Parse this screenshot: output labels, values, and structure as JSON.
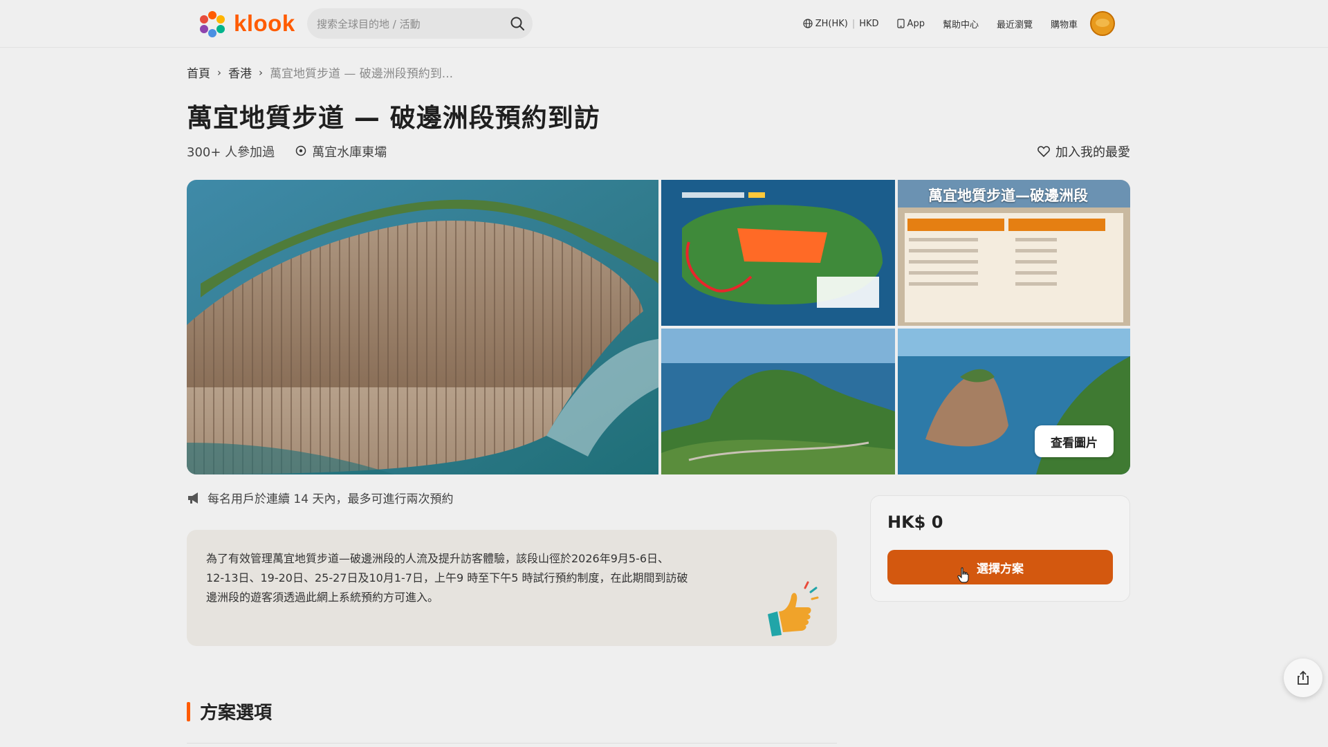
{
  "header": {
    "logo_text": "klook",
    "search_placeholder": "搜索全球目的地 / 活動",
    "nav": {
      "locale": "ZH(HK)",
      "currency": "HKD",
      "app": "App",
      "help": "幫助中心",
      "recent": "最近瀏覽",
      "cart": "購物車"
    }
  },
  "breadcrumb": {
    "home": "首頁",
    "region": "香港",
    "current": "萬宜地質步道 — 破邊洲段預約到..."
  },
  "activity": {
    "title": "萬宜地質步道 — 破邊洲段預約到訪",
    "participants": "300+ 人參加過",
    "location": "萬宜水庫東壩",
    "favorite_label": "加入我的最愛"
  },
  "gallery": {
    "table_image_heading": "萬宜地質步道—破邊洲段",
    "view_photos_label": "查看圖片"
  },
  "notice": "每名用戶於連續 14 天內，最多可進行兩次預約",
  "info": {
    "line1": "為了有效管理萬宜地質步道—破邊洲段的人流及提升訪客體驗，該段山徑於2026年9月5-6日、",
    "line2": "12-13日、19-20日、25-27日及10月1-7日，上午9 時至下午5 時試行預約制度，在此期間到訪破",
    "line3": "邊洲段的遊客須透過此網上系統預約方可進入。"
  },
  "price_card": {
    "price": "HK$ 0",
    "button_label": "選擇方案"
  },
  "section": {
    "title": "方案選項"
  },
  "colors": {
    "brand": "#ff5b00",
    "button": "#d3580f",
    "background": "#efefef"
  }
}
